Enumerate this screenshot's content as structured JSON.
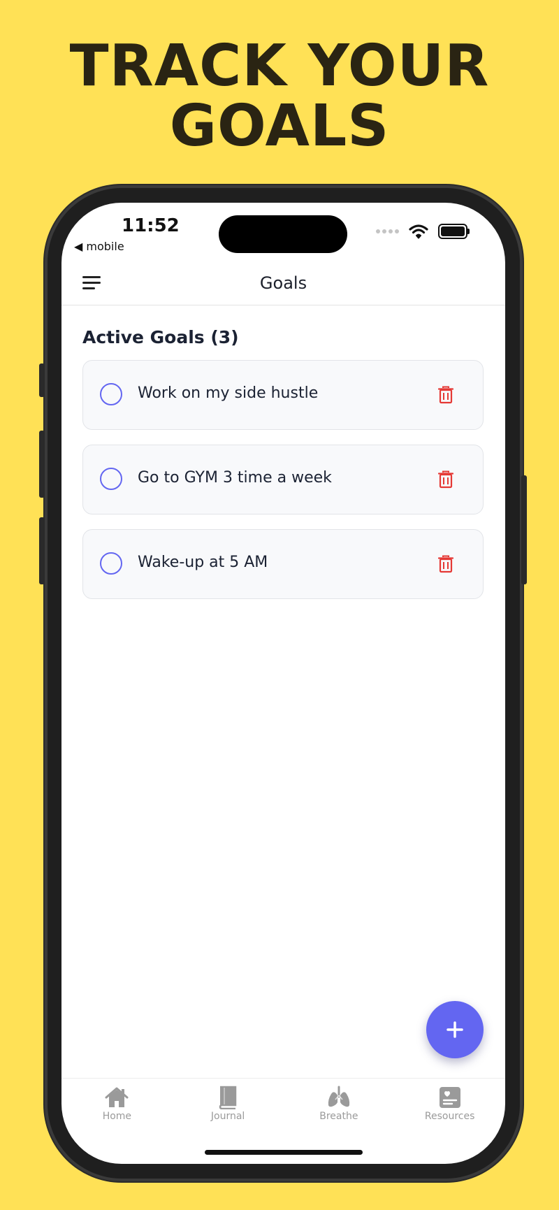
{
  "headline": {
    "line1": "TRACK YOUR",
    "line2": "GOALS"
  },
  "status_bar": {
    "time": "11:52",
    "back_label": "◀ mobile"
  },
  "navbar": {
    "title": "Goals"
  },
  "section": {
    "title": "Active Goals (3)"
  },
  "goals": [
    {
      "text": "Work on my side hustle"
    },
    {
      "text": "Go to GYM 3 time a week"
    },
    {
      "text": "Wake-up at 5 AM"
    }
  ],
  "fab": {
    "icon": "plus-icon"
  },
  "tabs": [
    {
      "label": "Home",
      "icon": "home-icon"
    },
    {
      "label": "Journal",
      "icon": "book-icon"
    },
    {
      "label": "Breathe",
      "icon": "lungs-icon"
    },
    {
      "label": "Resources",
      "icon": "resources-icon"
    }
  ],
  "colors": {
    "background": "#FFE156",
    "accent": "#6366F1",
    "delete": "#E53935",
    "tab_inactive": "#9A9A9A"
  }
}
